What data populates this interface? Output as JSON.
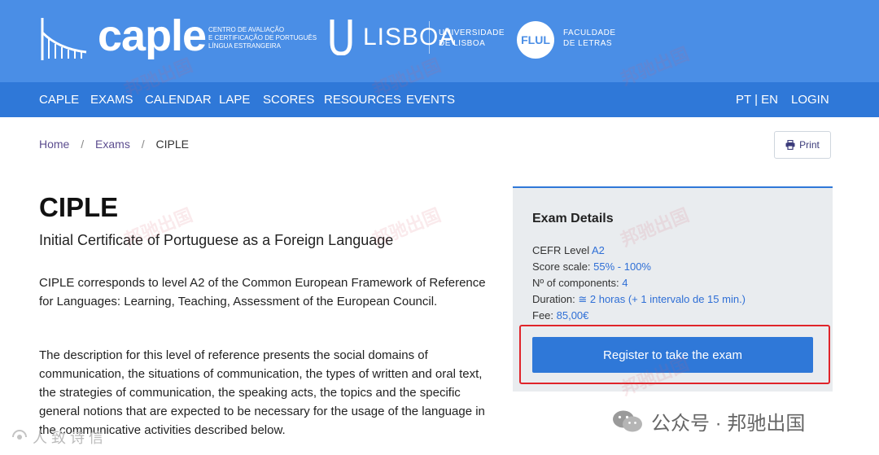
{
  "brand": {
    "caple_word": "caple",
    "caple_sub": [
      "CENTRO DE AVALIAÇÃO",
      "E CERTIFICAÇÃO DE PORTUGUÊS",
      "LÍNGUA ESTRANGEIRA"
    ],
    "lisboa_word": "LISBOA",
    "lisboa_sub": [
      "UNIVERSIDADE",
      "DE LISBOA"
    ],
    "flul_mark": "FLUL",
    "flul_sub": [
      "FACULDADE",
      "DE LETRAS"
    ]
  },
  "nav": {
    "items": [
      "CAPLE",
      "EXAMS",
      "CALENDAR",
      "LAPE",
      "SCORES",
      "RESOURCES",
      "EVENTS"
    ],
    "language": "PT | EN",
    "login": "LOGIN"
  },
  "breadcrumb": {
    "home": "Home",
    "sep": "/",
    "exams": "Exams",
    "current": "CIPLE"
  },
  "print_label": "Print",
  "main": {
    "title": "CIPLE",
    "subtitle": "Initial Certificate of Portuguese as a Foreign Language",
    "paragraph1": "CIPLE corresponds to level A2 of the Common European Framework of Reference for Languages: Learning, Teaching, Assessment of the European Council.",
    "paragraph2": "The description for this level of reference presents the social domains of communication, the situations of communication, the types of written and oral text, the strategies of communication, the speaking acts, the topics and the specific general notions that are expected to be necessary for the usage of the language in the communicative activities described below."
  },
  "details": {
    "title": "Exam Details",
    "rows": [
      {
        "label": "CEFR Level ",
        "value": "A2"
      },
      {
        "label": "Score scale: ",
        "value": "55% - 100%"
      },
      {
        "label": "Nº of components: ",
        "value": "4"
      },
      {
        "label": "Duration: ",
        "value": "≅ 2 horas (+ 1 intervalo de 15 min.)"
      },
      {
        "label": "Fee: ",
        "value": "85,00€"
      }
    ],
    "register_label": "Register to take the exam"
  },
  "overlay": {
    "watermark": "邦驰出国",
    "wechat_text": "公众号 · 邦驰出国",
    "corner_text": "人 致 诗 信"
  },
  "colors": {
    "brand_bar": "#4a8ee6",
    "nav_bar": "#2f78d8",
    "link": "#2f6fd6",
    "highlight": "#e0242a"
  }
}
